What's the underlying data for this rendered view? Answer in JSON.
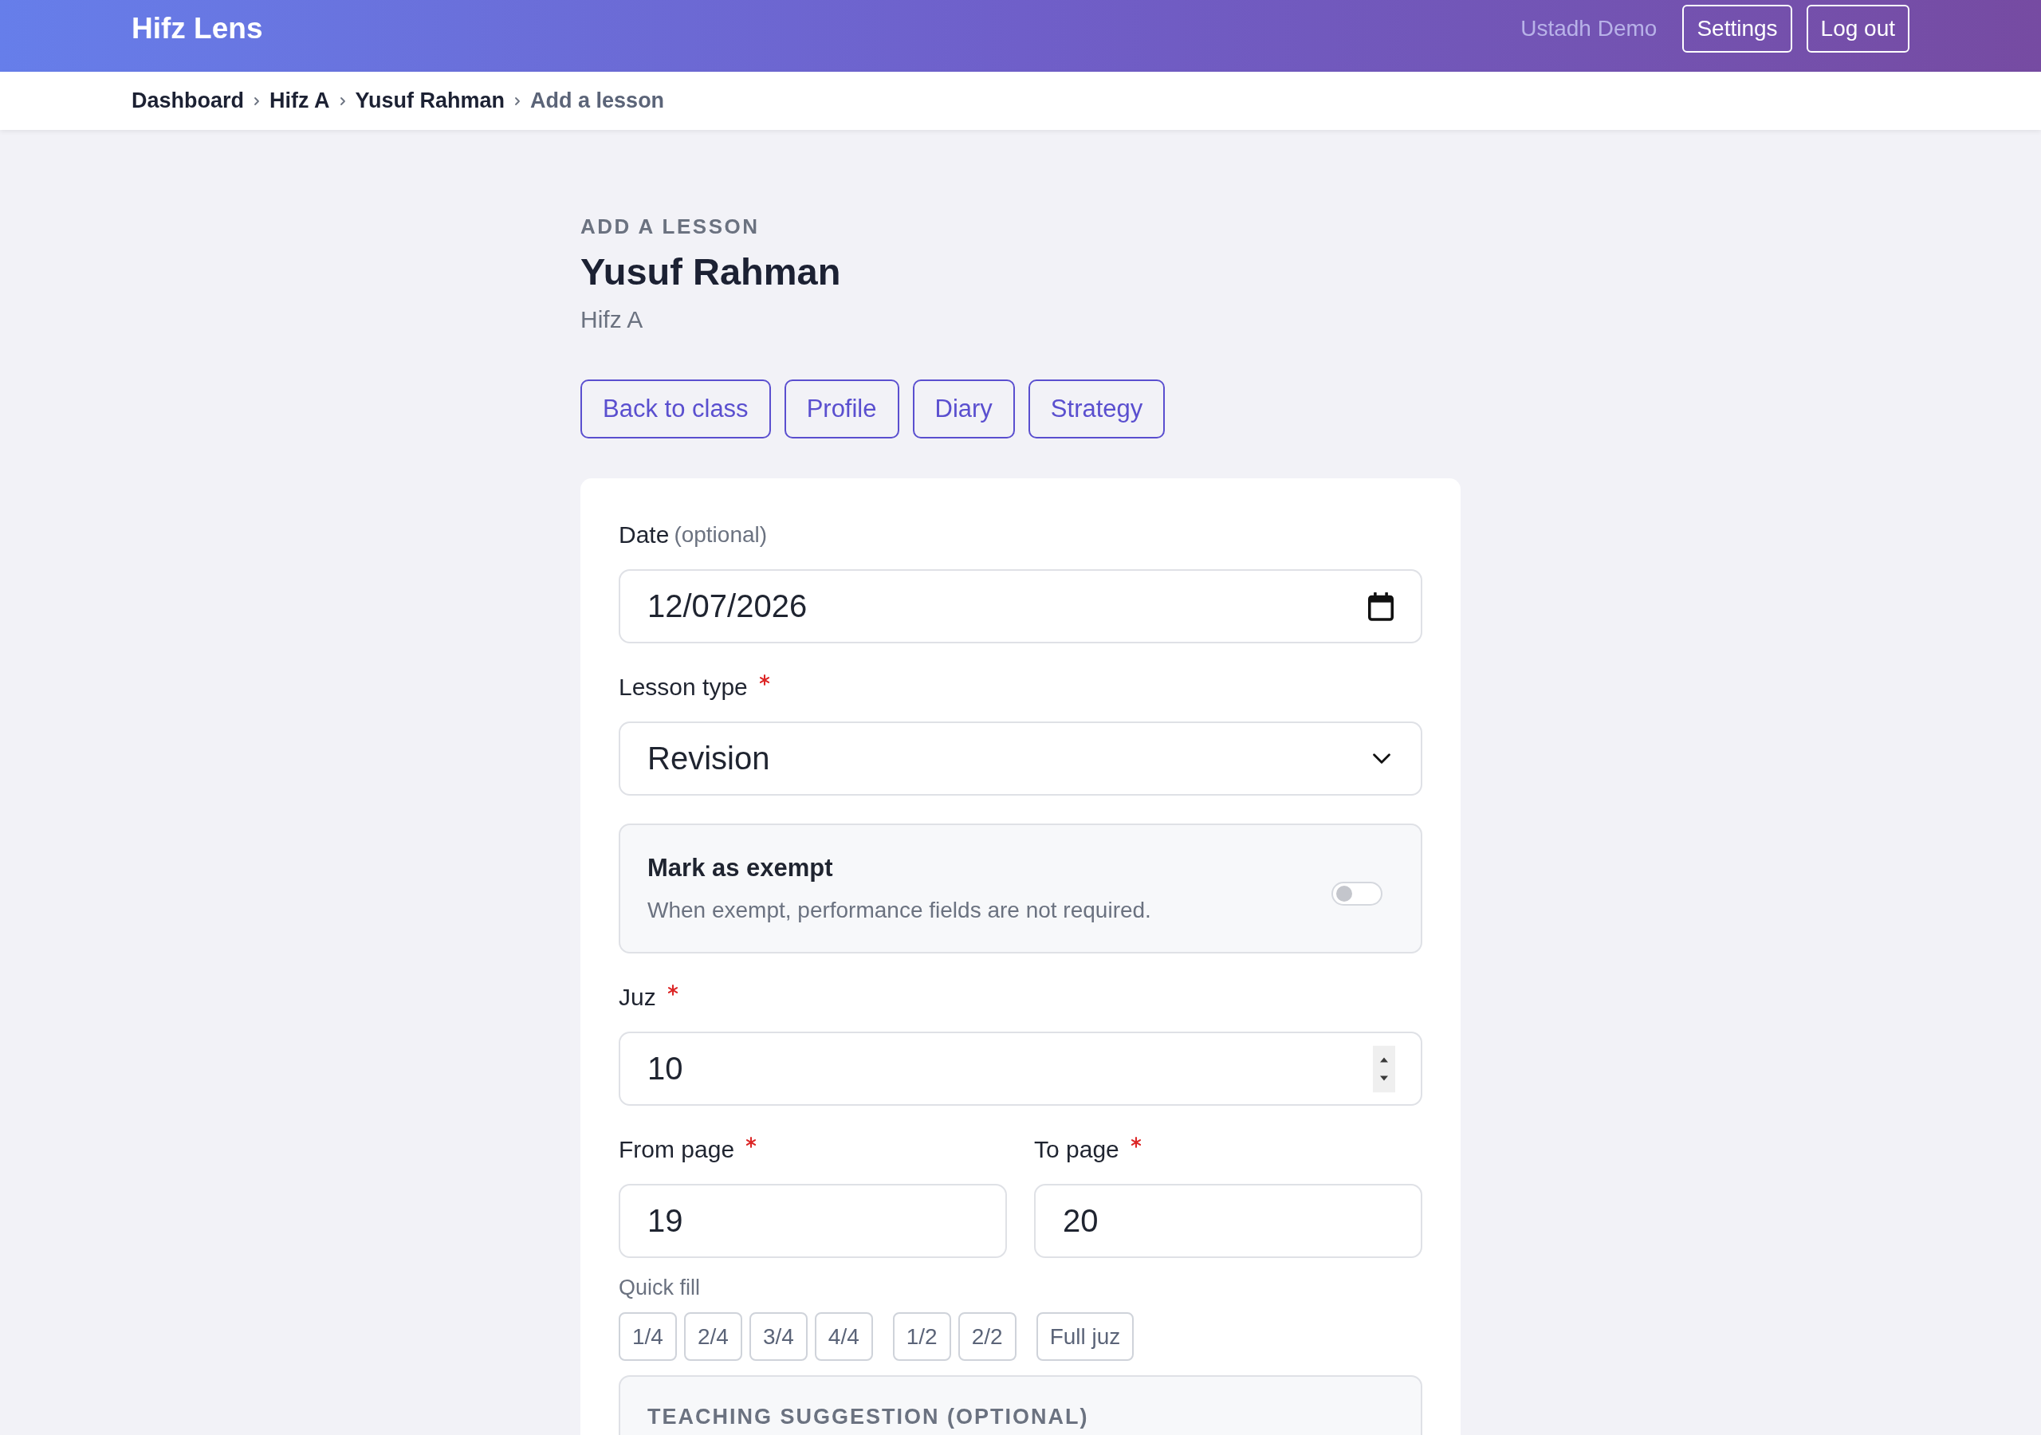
{
  "header": {
    "brand": "Hifz Lens",
    "user": "Ustadh Demo",
    "buttons": [
      "Settings",
      "Log out"
    ]
  },
  "breadcrumb": [
    {
      "label": "Dashboard",
      "current": false
    },
    {
      "label": "Hifz A",
      "current": false
    },
    {
      "label": "Yusuf Rahman",
      "current": false
    },
    {
      "label": "Add a lesson",
      "current": true
    }
  ],
  "page": {
    "eyebrow": "ADD A LESSON",
    "title": "Yusuf Rahman",
    "subtitle": "Hifz A"
  },
  "actions": [
    "Back to class",
    "Profile",
    "Diary",
    "Strategy"
  ],
  "form": {
    "date": {
      "label": "Date",
      "hint": "(optional)",
      "required": false,
      "value": "12/07/2026"
    },
    "lesson_type": {
      "label": "Lesson type",
      "required": true,
      "value": "Revision"
    },
    "exempt": {
      "title": "Mark as exempt",
      "description": "When exempt, performance fields are not required.",
      "on": false
    },
    "juz": {
      "label": "Juz",
      "required": true,
      "value": "10"
    },
    "from_page": {
      "label": "From page",
      "required": true,
      "value": "19"
    },
    "to_page": {
      "label": "To page",
      "required": true,
      "value": "20"
    },
    "quick_fill": {
      "label": "Quick fill",
      "groups": [
        [
          "1/4",
          "2/4",
          "3/4",
          "4/4"
        ],
        [
          "1/2",
          "2/2"
        ],
        [
          "Full juz"
        ]
      ]
    },
    "teaching_suggestion": {
      "title": "TEACHING SUGGESTION (OPTIONAL)"
    }
  }
}
